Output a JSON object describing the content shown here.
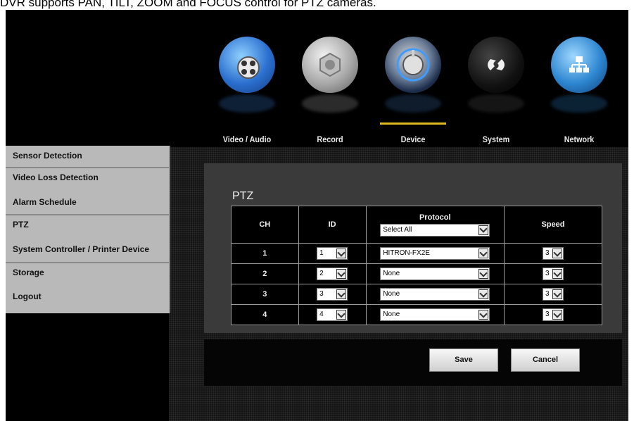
{
  "caption": "DVR supports PAN, TILT, ZOOM and FOCUS control for PTZ cameras.",
  "nav": [
    {
      "label": "Video / Audio",
      "icon": "video-audio-icon",
      "color": "#3b7fd8"
    },
    {
      "label": "Record",
      "icon": "record-icon",
      "color": "#9a9a9a"
    },
    {
      "label": "Device",
      "icon": "device-icon",
      "color": "#2b5fa8",
      "active": true
    },
    {
      "label": "System",
      "icon": "system-icon",
      "color": "#111111"
    },
    {
      "label": "Network",
      "icon": "network-icon",
      "color": "#2f8fd8"
    }
  ],
  "sidebar": [
    "Sensor Detection",
    "Video Loss Detection",
    "Alarm Schedule",
    "PTZ",
    "System Controller / Printer Device",
    "Storage",
    "Logout"
  ],
  "panel": {
    "title": "PTZ",
    "headers": {
      "ch": "CH",
      "id": "ID",
      "protocol": "Protocol",
      "speed": "Speed"
    },
    "protocol_all": "Select All",
    "rows": [
      {
        "ch": "1",
        "id": "1",
        "protocol": "HITRON-FX2E",
        "speed": "3"
      },
      {
        "ch": "2",
        "id": "2",
        "protocol": "None",
        "speed": "3"
      },
      {
        "ch": "3",
        "id": "3",
        "protocol": "None",
        "speed": "3"
      },
      {
        "ch": "4",
        "id": "4",
        "protocol": "None",
        "speed": "3"
      }
    ]
  },
  "buttons": {
    "save": "Save",
    "cancel": "Cancel"
  },
  "accent": "#e0b81f"
}
